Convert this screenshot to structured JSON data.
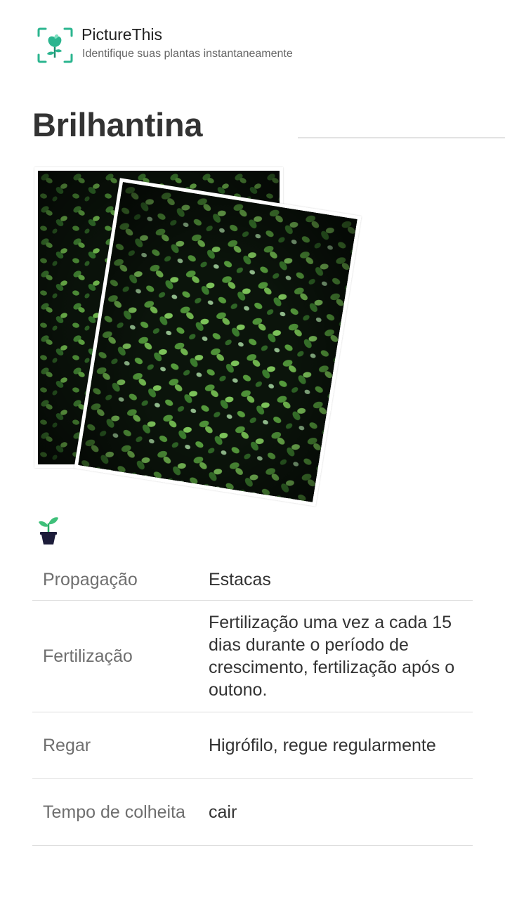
{
  "header": {
    "app_name": "PictureThis",
    "tagline": "Identifique suas plantas instantaneamente",
    "logo_icon": "leaf-scan-icon",
    "accent_color": "#2bb58f"
  },
  "plant": {
    "name": "Brilhantina"
  },
  "care": {
    "icon": "potted-sprout-icon",
    "rows": [
      {
        "label": "Propagação",
        "value": "Estacas"
      },
      {
        "label": "Fertilização",
        "value": "Fertilização uma vez a cada 15 dias durante o período de crescimento, fertilização após o outono."
      },
      {
        "label": "Regar",
        "value": "Higrófilo, regue regularmente"
      },
      {
        "label": "Tempo de colheita",
        "value": "cair"
      }
    ]
  }
}
